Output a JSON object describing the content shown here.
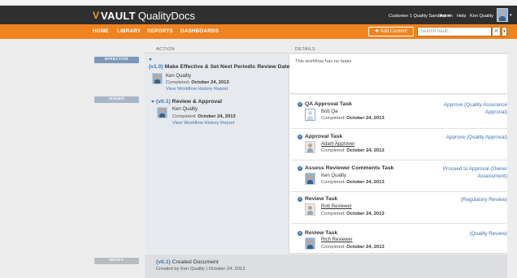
{
  "app": {
    "logo_mark": "V",
    "logo_brand": "VAULT",
    "logo_product": "Quality",
    "logo_suffix": "Docs"
  },
  "topbar": {
    "sandbox": "Customer 1 Quality Sandbox ▾",
    "admin": "Admin",
    "help": "Help",
    "user": "Ken Quality"
  },
  "nav": {
    "home": "HOME",
    "library": "LIBRARY",
    "reports": "REPORTS",
    "dashboards": "DASHBOARDS",
    "add_content": "✚ Add Content",
    "search_placeholder": "Search Vault...",
    "search_icon": "🔍",
    "dropdown_icon": "▾"
  },
  "columns": {
    "action": "ACTION",
    "details": "DETAILS"
  },
  "sections": {
    "effective": {
      "badge": "EFFECTIVE",
      "version": "(v1.0)",
      "title": "Make Effective & Set Next Periodic Review Date",
      "user": "Ken Quality",
      "completed_label": "Completed:",
      "completed_date": "October 24, 2013",
      "link": "View Workflow History Report",
      "details": "This workflow has no tasks."
    },
    "issued": {
      "badge": "ISSUED",
      "version": "(v0.1)",
      "title": "Review & Approval",
      "user": "Ken Quality",
      "completed_label": "Completed:",
      "completed_date": "October 24, 2013",
      "link": "View Workflow History Report",
      "tasks": [
        {
          "name": "QA Approval Task",
          "user": "Bob Qa",
          "completed": "October 24, 2013",
          "outcome": "Approve (Quality Assurance Approval)"
        },
        {
          "name": "Approval Task",
          "user": "Adam Approver",
          "completed": "October 24, 2013",
          "outcome": "Approve (Quality Approval)"
        },
        {
          "name": "Assess Reviewer Comments Task",
          "user": "Ken Quality",
          "completed": "October 24, 2013",
          "outcome": "Proceed to Approval (Owner Assessment)"
        },
        {
          "name": "Review Task",
          "user": "Rob Reviewer",
          "completed": "October 24, 2013",
          "outcome": "(Regulatory Review)"
        },
        {
          "name": "Review Task",
          "user": "Rich Reviewer",
          "completed": "October 24, 2013",
          "outcome": "(Quality Review)"
        }
      ]
    },
    "draft": {
      "badge": "DRAFT",
      "version": "(v0.1)",
      "title": "Created Document",
      "subtitle": "Created by Ken Quality | October 24, 2013"
    }
  },
  "colors": {
    "orange": "#ef8320",
    "dark": "#2f2f2f",
    "link": "#3b74b8",
    "effective_badge": "#7c99b9",
    "issued_badge": "#a9b6c6",
    "draft_badge": "#b9bcc0"
  }
}
